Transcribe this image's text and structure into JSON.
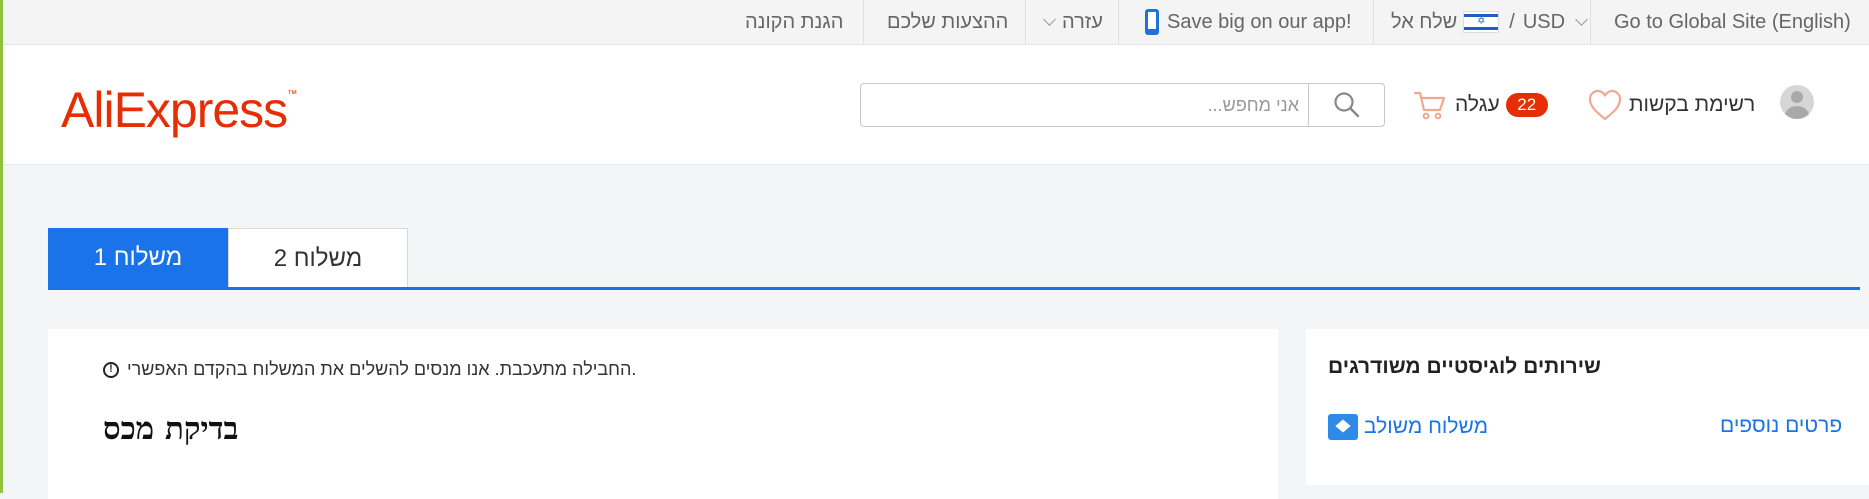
{
  "topbar": {
    "global_site": "Go to Global Site (English)",
    "currency": "USD",
    "separator": "/",
    "ship_to": "שלח אל",
    "app_promo": "Save big on our app!",
    "help": "עזרה",
    "suggestions": "ההצעות שלכם",
    "buyer_protection": "הגנת הקונה"
  },
  "header": {
    "logo": "AliExpress",
    "logo_tm": "™",
    "search_placeholder": "אני מחפש...",
    "cart_count": "22",
    "cart_label": "עגלה",
    "wishlist_label": "רשימת בקשות"
  },
  "tabs": [
    {
      "label": "משלוח 1",
      "active": true
    },
    {
      "label": "משלוח 2",
      "active": false
    }
  ],
  "main": {
    "notice_icon": "!",
    "notice": "החבילה מתעכבת. אנו מנסים להשלים את המשלוח בהקדם האפשרי.",
    "customs_title": "בדיקת מכס"
  },
  "side": {
    "title": "שירותים לוגיסטיים משודרגים",
    "combined_shipping": "משלוח משולב",
    "more_details": "פרטים נוספים"
  },
  "colors": {
    "brand": "#e62e04",
    "accent": "#1a73e8"
  }
}
